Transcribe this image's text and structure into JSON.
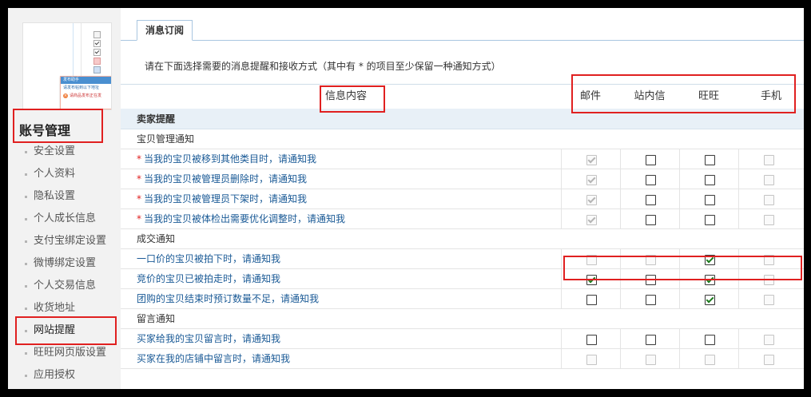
{
  "sidebar": {
    "preview": {
      "popup_title": "发布助手",
      "popup_line": "请发布帖到以下地址",
      "popup_warning": "请商品发布正在发"
    },
    "section_title": "账号管理",
    "items": [
      {
        "label": "安全设置"
      },
      {
        "label": "个人资料"
      },
      {
        "label": "隐私设置"
      },
      {
        "label": "个人成长信息"
      },
      {
        "label": "支付宝绑定设置"
      },
      {
        "label": "微博绑定设置"
      },
      {
        "label": "个人交易信息"
      },
      {
        "label": "收货地址"
      },
      {
        "label": "网站提醒",
        "active": true
      },
      {
        "label": "旺旺网页版设置"
      },
      {
        "label": "应用授权"
      }
    ]
  },
  "main": {
    "tab": "消息订阅",
    "instruction": "请在下面选择需要的消息提醒和接收方式（其中有 * 的项目至少保留一种通知方式）",
    "columns": {
      "info": "信息内容",
      "email": "邮件",
      "site": "站内信",
      "wangwang": "旺旺",
      "mobile": "手机"
    },
    "group_title": "卖家提醒",
    "sections": [
      {
        "title": "宝贝管理通知",
        "rows": [
          {
            "label": "当我的宝贝被移到其他类目时，请通知我",
            "required": true,
            "checks": [
              {
                "on": true,
                "disabled": true
              },
              {
                "on": false,
                "disabled": false
              },
              {
                "on": false,
                "disabled": false
              },
              {
                "on": false,
                "disabled": true
              }
            ]
          },
          {
            "label": "当我的宝贝被管理员删除时，请通知我",
            "required": true,
            "checks": [
              {
                "on": true,
                "disabled": true
              },
              {
                "on": false,
                "disabled": false
              },
              {
                "on": false,
                "disabled": false
              },
              {
                "on": false,
                "disabled": true
              }
            ]
          },
          {
            "label": "当我的宝贝被管理员下架时，请通知我",
            "required": true,
            "checks": [
              {
                "on": true,
                "disabled": true
              },
              {
                "on": false,
                "disabled": false
              },
              {
                "on": false,
                "disabled": false
              },
              {
                "on": false,
                "disabled": true
              }
            ]
          },
          {
            "label": "当我的宝贝被体检出需要优化调整时，请通知我",
            "required": true,
            "checks": [
              {
                "on": true,
                "disabled": true
              },
              {
                "on": false,
                "disabled": false
              },
              {
                "on": false,
                "disabled": false
              },
              {
                "on": false,
                "disabled": true
              }
            ]
          }
        ]
      },
      {
        "title": "成交通知",
        "rows": [
          {
            "label": "一口价的宝贝被拍下时，请通知我",
            "required": false,
            "checks": [
              {
                "on": false,
                "disabled": true
              },
              {
                "on": false,
                "disabled": true
              },
              {
                "on": true,
                "disabled": false
              },
              {
                "on": false,
                "disabled": true
              }
            ]
          },
          {
            "label": "竞价的宝贝已被拍走时，请通知我",
            "required": false,
            "checks": [
              {
                "on": true,
                "disabled": false
              },
              {
                "on": false,
                "disabled": false
              },
              {
                "on": true,
                "disabled": false
              },
              {
                "on": false,
                "disabled": true
              }
            ]
          },
          {
            "label": "团购的宝贝结束时预订数量不足，请通知我",
            "required": false,
            "checks": [
              {
                "on": false,
                "disabled": false
              },
              {
                "on": false,
                "disabled": false
              },
              {
                "on": true,
                "disabled": false
              },
              {
                "on": false,
                "disabled": true
              }
            ]
          }
        ]
      },
      {
        "title": "留言通知",
        "rows": [
          {
            "label": "买家给我的宝贝留言时，请通知我",
            "required": false,
            "checks": [
              {
                "on": false,
                "disabled": false
              },
              {
                "on": false,
                "disabled": false
              },
              {
                "on": false,
                "disabled": false
              },
              {
                "on": false,
                "disabled": true
              }
            ]
          },
          {
            "label": "买家在我的店铺中留言时，请通知我",
            "required": false,
            "checks": [
              {
                "on": false,
                "disabled": true
              },
              {
                "on": false,
                "disabled": true
              },
              {
                "on": false,
                "disabled": true
              },
              {
                "on": false,
                "disabled": true
              }
            ]
          }
        ]
      }
    ]
  },
  "colors": {
    "highlight_box": "#e02020",
    "link": "#1a5a96",
    "group_bg": "#e8f0f7",
    "check": "#1c7a1c"
  }
}
